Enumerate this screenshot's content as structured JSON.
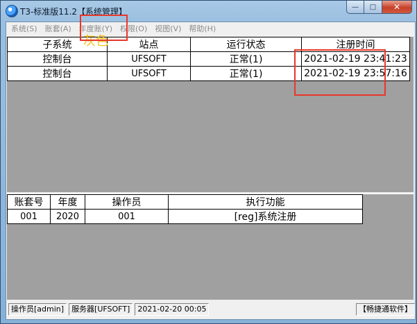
{
  "window": {
    "title": "T3-标准版11.2【系统管理】",
    "minimize_glyph": "—",
    "maximize_glyph": "□",
    "close_glyph": "✕"
  },
  "menubar": {
    "items": [
      {
        "label": "系统(S)"
      },
      {
        "label": "账套(A)"
      },
      {
        "label": "年度账(Y)"
      },
      {
        "label": "权限(O)"
      },
      {
        "label": "视图(V)"
      },
      {
        "label": "帮助(H)"
      }
    ]
  },
  "subsystem_table": {
    "headers": [
      "子系统",
      "站点",
      "运行状态",
      "注册时间"
    ],
    "rows": [
      [
        "控制台",
        "UFSOFT",
        "正常(1)",
        "2021-02-19 23:41:23"
      ],
      [
        "控制台",
        "UFSOFT",
        "正常(1)",
        "2021-02-19 23:57:16"
      ]
    ]
  },
  "annotation": {
    "text": "灰色",
    "color": "#f3c21c"
  },
  "task_table": {
    "headers": [
      "账套号",
      "年度",
      "操作员",
      "执行功能"
    ],
    "rows": [
      [
        "001",
        "2020",
        "001",
        "[reg]系统注册"
      ]
    ]
  },
  "statusbar": {
    "operator": "操作员[admin]",
    "server": "服务器[UFSOFT]",
    "datetime": "2021-02-20 00:05",
    "brand": "【畅捷通软件】"
  },
  "colors": {
    "highlight": "#e8362a",
    "disabled_menu": "#8a8a8a",
    "empty_area": "#a0a0a0"
  }
}
